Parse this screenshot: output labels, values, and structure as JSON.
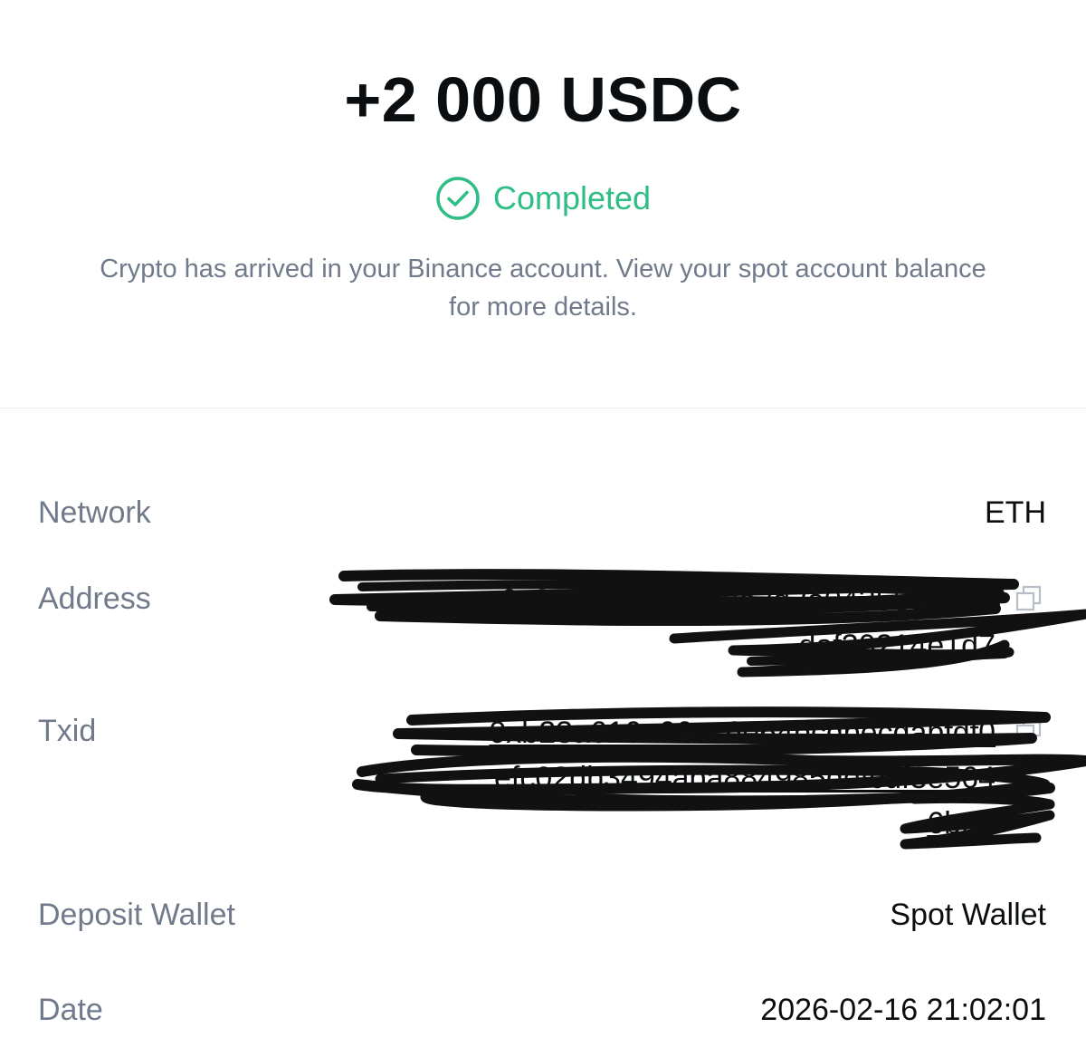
{
  "header": {
    "amount": "+2 000 USDC",
    "status": "Completed",
    "status_color": "#2ebd85",
    "status_icon": "check-circle-icon",
    "message": "Crypto has arrived in your Binance account. View your spot account balance for more details."
  },
  "details": {
    "network": {
      "label": "Network",
      "value": "ETH"
    },
    "address": {
      "label": "Address",
      "lines": [
        "0x226efdf9520d8a3d3a0435655484",
        "daf30214e1d7"
      ],
      "copy_icon": "copy-icon"
    },
    "txid": {
      "label": "Txid",
      "lines": [
        "0xb23a616a66ec6e64bcdbecdabfdf0",
        "efc02db3494aba884985defcdf3e564",
        "6b9d"
      ],
      "copy_icon": "copy-icon"
    },
    "deposit_wallet": {
      "label": "Deposit Wallet",
      "value": "Spot Wallet"
    },
    "date": {
      "label": "Date",
      "value": "2026-02-16 21:02:01"
    }
  }
}
